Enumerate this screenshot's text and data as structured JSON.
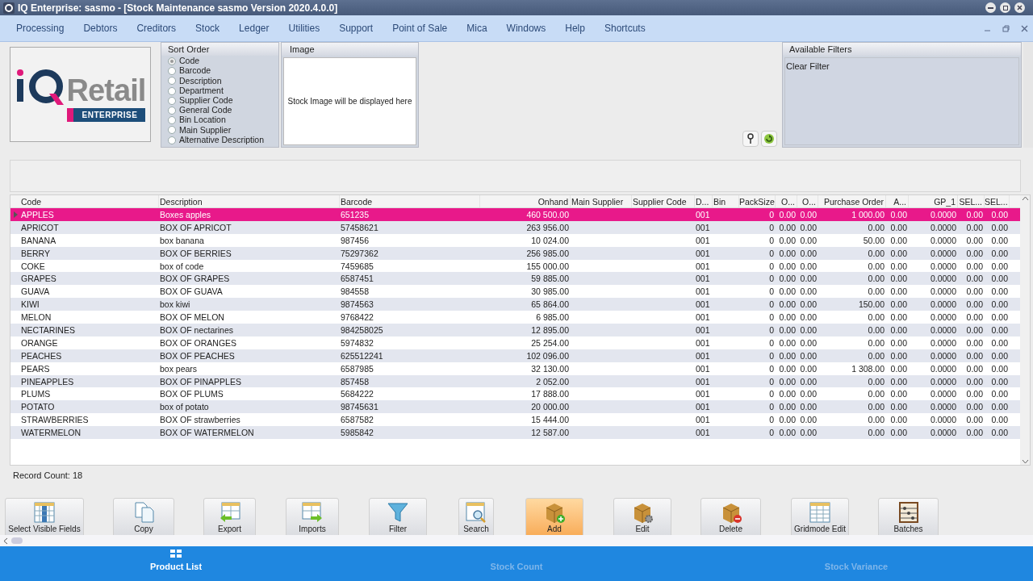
{
  "window": {
    "title": "IQ Enterprise: sasmo - [Stock Maintenance sasmo Version 2020.4.0.0]"
  },
  "menu": [
    "Processing",
    "Debtors",
    "Creditors",
    "Stock",
    "Ledger",
    "Utilities",
    "Support",
    "Point of Sale",
    "Mica",
    "Windows",
    "Help",
    "Shortcuts"
  ],
  "logo": {
    "word": "Retail",
    "badge": "ENTERPRISE"
  },
  "sort_order": {
    "title": "Sort Order",
    "options": [
      {
        "label": "Code",
        "selected": true
      },
      {
        "label": "Barcode",
        "selected": false
      },
      {
        "label": "Description",
        "selected": false
      },
      {
        "label": "Department",
        "selected": false
      },
      {
        "label": "Supplier Code",
        "selected": false
      },
      {
        "label": "General Code",
        "selected": false
      },
      {
        "label": "Bin Location",
        "selected": false
      },
      {
        "label": "Main Supplier",
        "selected": false
      },
      {
        "label": "Alternative Description",
        "selected": false
      }
    ]
  },
  "image_panel": {
    "title": "Image",
    "message": "Stock Image will be displayed here"
  },
  "filters": {
    "title": "Available Filters",
    "items": [
      "Clear Filter"
    ]
  },
  "table": {
    "columns": [
      {
        "label": "Code"
      },
      {
        "label": "Description"
      },
      {
        "label": "Barcode"
      },
      {
        "label": "Onhand"
      },
      {
        "label": "Main Supplier"
      },
      {
        "label": "Supplier Code"
      },
      {
        "label": "D..."
      },
      {
        "label": "Bin"
      },
      {
        "label": "PackSize"
      },
      {
        "label": "O..."
      },
      {
        "label": "O..."
      },
      {
        "label": "Purchase Order"
      },
      {
        "label": "A..."
      },
      {
        "label": "GP_1"
      },
      {
        "label": "SEL..."
      },
      {
        "label": "SEL..."
      }
    ],
    "rows": [
      {
        "selected": true,
        "code": "APPLES",
        "description": "Boxes apples",
        "barcode": "651235",
        "onhand": "460 500.00",
        "department": "001",
        "pack_size": "0",
        "o_1": "0.00",
        "o_2": "0.00",
        "purchase_order": "1 000.00",
        "a": "0.00",
        "gp_1": "0.0000",
        "sel_1": "0.00",
        "sel_2": "0.00"
      },
      {
        "selected": false,
        "code": "APRICOT",
        "description": "BOX OF APRICOT",
        "barcode": "57458621",
        "onhand": "263 956.00",
        "department": "001",
        "pack_size": "0",
        "o_1": "0.00",
        "o_2": "0.00",
        "purchase_order": "0.00",
        "a": "0.00",
        "gp_1": "0.0000",
        "sel_1": "0.00",
        "sel_2": "0.00"
      },
      {
        "selected": false,
        "code": "BANANA",
        "description": "box banana",
        "barcode": "987456",
        "onhand": "10 024.00",
        "department": "001",
        "pack_size": "0",
        "o_1": "0.00",
        "o_2": "0.00",
        "purchase_order": "50.00",
        "a": "0.00",
        "gp_1": "0.0000",
        "sel_1": "0.00",
        "sel_2": "0.00"
      },
      {
        "selected": false,
        "code": "BERRY",
        "description": "BOX OF BERRIES",
        "barcode": "75297362",
        "onhand": "256 985.00",
        "department": "001",
        "pack_size": "0",
        "o_1": "0.00",
        "o_2": "0.00",
        "purchase_order": "0.00",
        "a": "0.00",
        "gp_1": "0.0000",
        "sel_1": "0.00",
        "sel_2": "0.00"
      },
      {
        "selected": false,
        "code": "COKE",
        "description": "box of code",
        "barcode": "7459685",
        "onhand": "155 000.00",
        "department": "001",
        "pack_size": "0",
        "o_1": "0.00",
        "o_2": "0.00",
        "purchase_order": "0.00",
        "a": "0.00",
        "gp_1": "0.0000",
        "sel_1": "0.00",
        "sel_2": "0.00"
      },
      {
        "selected": false,
        "code": "GRAPES",
        "description": "BOX OF GRAPES",
        "barcode": "6587451",
        "onhand": "59 885.00",
        "department": "001",
        "pack_size": "0",
        "o_1": "0.00",
        "o_2": "0.00",
        "purchase_order": "0.00",
        "a": "0.00",
        "gp_1": "0.0000",
        "sel_1": "0.00",
        "sel_2": "0.00"
      },
      {
        "selected": false,
        "code": "GUAVA",
        "description": "BOX OF GUAVA",
        "barcode": "984558",
        "onhand": "30 985.00",
        "department": "001",
        "pack_size": "0",
        "o_1": "0.00",
        "o_2": "0.00",
        "purchase_order": "0.00",
        "a": "0.00",
        "gp_1": "0.0000",
        "sel_1": "0.00",
        "sel_2": "0.00"
      },
      {
        "selected": false,
        "code": "KIWI",
        "description": "box kiwi",
        "barcode": "9874563",
        "onhand": "65 864.00",
        "department": "001",
        "pack_size": "0",
        "o_1": "0.00",
        "o_2": "0.00",
        "purchase_order": "150.00",
        "a": "0.00",
        "gp_1": "0.0000",
        "sel_1": "0.00",
        "sel_2": "0.00"
      },
      {
        "selected": false,
        "code": "MELON",
        "description": "BOX OF MELON",
        "barcode": "9768422",
        "onhand": "6 985.00",
        "department": "001",
        "pack_size": "0",
        "o_1": "0.00",
        "o_2": "0.00",
        "purchase_order": "0.00",
        "a": "0.00",
        "gp_1": "0.0000",
        "sel_1": "0.00",
        "sel_2": "0.00"
      },
      {
        "selected": false,
        "code": "NECTARINES",
        "description": "BOX OF nectarines",
        "barcode": "984258025",
        "onhand": "12 895.00",
        "department": "001",
        "pack_size": "0",
        "o_1": "0.00",
        "o_2": "0.00",
        "purchase_order": "0.00",
        "a": "0.00",
        "gp_1": "0.0000",
        "sel_1": "0.00",
        "sel_2": "0.00"
      },
      {
        "selected": false,
        "code": "ORANGE",
        "description": "BOX OF ORANGES",
        "barcode": "5974832",
        "onhand": "25 254.00",
        "department": "001",
        "pack_size": "0",
        "o_1": "0.00",
        "o_2": "0.00",
        "purchase_order": "0.00",
        "a": "0.00",
        "gp_1": "0.0000",
        "sel_1": "0.00",
        "sel_2": "0.00"
      },
      {
        "selected": false,
        "code": "PEACHES",
        "description": "BOX OF PEACHES",
        "barcode": "625512241",
        "onhand": "102 096.00",
        "department": "001",
        "pack_size": "0",
        "o_1": "0.00",
        "o_2": "0.00",
        "purchase_order": "0.00",
        "a": "0.00",
        "gp_1": "0.0000",
        "sel_1": "0.00",
        "sel_2": "0.00"
      },
      {
        "selected": false,
        "code": "PEARS",
        "description": "box pears",
        "barcode": "6587985",
        "onhand": "32 130.00",
        "department": "001",
        "pack_size": "0",
        "o_1": "0.00",
        "o_2": "0.00",
        "purchase_order": "1 308.00",
        "a": "0.00",
        "gp_1": "0.0000",
        "sel_1": "0.00",
        "sel_2": "0.00"
      },
      {
        "selected": false,
        "code": "PINEAPPLES",
        "description": "BOX OF PINAPPLES",
        "barcode": "857458",
        "onhand": "2 052.00",
        "department": "001",
        "pack_size": "0",
        "o_1": "0.00",
        "o_2": "0.00",
        "purchase_order": "0.00",
        "a": "0.00",
        "gp_1": "0.0000",
        "sel_1": "0.00",
        "sel_2": "0.00"
      },
      {
        "selected": false,
        "code": "PLUMS",
        "description": "BOX OF PLUMS",
        "barcode": "5684222",
        "onhand": "17 888.00",
        "department": "001",
        "pack_size": "0",
        "o_1": "0.00",
        "o_2": "0.00",
        "purchase_order": "0.00",
        "a": "0.00",
        "gp_1": "0.0000",
        "sel_1": "0.00",
        "sel_2": "0.00"
      },
      {
        "selected": false,
        "code": "POTATO",
        "description": "box of potato",
        "barcode": "98745631",
        "onhand": "20 000.00",
        "department": "001",
        "pack_size": "0",
        "o_1": "0.00",
        "o_2": "0.00",
        "purchase_order": "0.00",
        "a": "0.00",
        "gp_1": "0.0000",
        "sel_1": "0.00",
        "sel_2": "0.00"
      },
      {
        "selected": false,
        "code": "STRAWBERRIES",
        "description": "BOX OF strawberries",
        "barcode": "6587582",
        "onhand": "15 444.00",
        "department": "001",
        "pack_size": "0",
        "o_1": "0.00",
        "o_2": "0.00",
        "purchase_order": "0.00",
        "a": "0.00",
        "gp_1": "0.0000",
        "sel_1": "0.00",
        "sel_2": "0.00"
      },
      {
        "selected": false,
        "code": "WATERMELON",
        "description": "BOX OF WATERMELON",
        "barcode": "5985842",
        "onhand": "12 587.00",
        "department": "001",
        "pack_size": "0",
        "o_1": "0.00",
        "o_2": "0.00",
        "purchase_order": "0.00",
        "a": "0.00",
        "gp_1": "0.0000",
        "sel_1": "0.00",
        "sel_2": "0.00"
      }
    ]
  },
  "record_count": "Record Count: 18",
  "toolbar": [
    {
      "kind": "columns",
      "label": "Select Visible Fields",
      "highlighted": false
    },
    {
      "kind": "copy",
      "label": "Copy",
      "highlighted": false
    },
    {
      "kind": "export",
      "label": "Export",
      "highlighted": false
    },
    {
      "kind": "import",
      "label": "Imports",
      "highlighted": false
    },
    {
      "kind": "filter",
      "label": "Filter",
      "highlighted": false
    },
    {
      "kind": "search",
      "label": "Search",
      "highlighted": false
    },
    {
      "kind": "add",
      "label": "Add",
      "highlighted": true
    },
    {
      "kind": "edit",
      "label": "Edit",
      "highlighted": false
    },
    {
      "kind": "delete",
      "label": "Delete",
      "highlighted": false
    },
    {
      "kind": "grid",
      "label": "Gridmode Edit",
      "highlighted": false
    },
    {
      "kind": "abacus",
      "label": "Batches",
      "highlighted": false
    }
  ],
  "bottom_tabs": [
    {
      "label": "Product List",
      "selected": true
    },
    {
      "label": "Stock Count",
      "selected": false
    },
    {
      "label": "Stock Variance",
      "selected": false
    }
  ]
}
